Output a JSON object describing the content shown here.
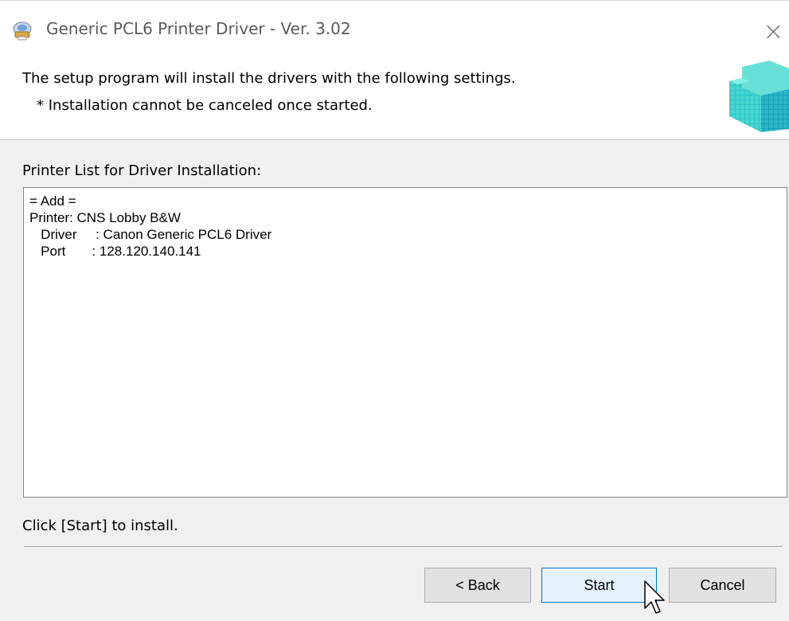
{
  "window": {
    "title": "Generic PCL6 Printer Driver - Ver. 3.02",
    "close_label": "×"
  },
  "header": {
    "line1": "The setup program will install the drivers with the following settings.",
    "line2": "* Installation cannot be canceled once started."
  },
  "list": {
    "label": "Printer List for Driver Installation:",
    "lines": [
      "= Add =",
      "Printer: CNS Lobby B&W",
      "   Driver     : Canon Generic PCL6 Driver",
      "   Port       : 128.120.140.141"
    ]
  },
  "hint": "Click [Start] to install.",
  "buttons": {
    "back": "< Back",
    "start": "Start",
    "cancel": "Cancel"
  },
  "icons": {
    "title": "printer-installer-icon",
    "header": "cube-stack-icon",
    "cursor": "mouse-pointer-icon"
  },
  "colors": {
    "accent": "#0078d7",
    "header_graphic": "#20b8c8"
  }
}
